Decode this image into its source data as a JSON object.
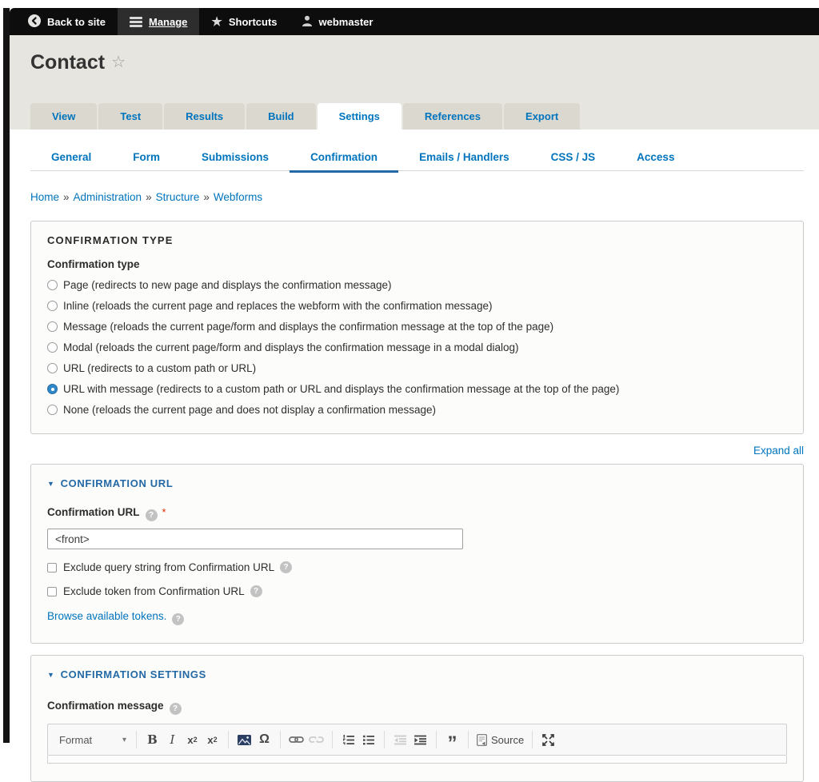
{
  "admin_toolbar": {
    "back_to_site": "Back to site",
    "manage": "Manage",
    "shortcuts": "Shortcuts",
    "user": "webmaster"
  },
  "header": {
    "title": "Contact"
  },
  "primary_tabs": {
    "items": [
      "View",
      "Test",
      "Results",
      "Build",
      "Settings",
      "References",
      "Export"
    ],
    "active_index": 4
  },
  "secondary_tabs": {
    "items": [
      "General",
      "Form",
      "Submissions",
      "Confirmation",
      "Emails / Handlers",
      "CSS / JS",
      "Access"
    ],
    "active_index": 3
  },
  "breadcrumb": {
    "items": [
      "Home",
      "Administration",
      "Structure",
      "Webforms"
    ],
    "separator": "»"
  },
  "confirmation_type": {
    "legend": "CONFIRMATION TYPE",
    "label": "Confirmation type",
    "options": [
      "Page (redirects to new page and displays the confirmation message)",
      "Inline (reloads the current page and replaces the webform with the confirmation message)",
      "Message (reloads the current page/form and displays the confirmation message at the top of the page)",
      "Modal (reloads the current page/form and displays the confirmation message in a modal dialog)",
      "URL (redirects to a custom path or URL)",
      "URL with message (redirects to a custom path or URL and displays the confirmation message at the top of the page)",
      "None (reloads the current page and does not display a confirmation message)"
    ],
    "selected_index": 5
  },
  "expand_all_label": "Expand all",
  "confirmation_url": {
    "summary": "CONFIRMATION URL",
    "label": "Confirmation URL",
    "value": "<front>",
    "exclude_query": "Exclude query string from Confirmation URL",
    "exclude_token": "Exclude token from Confirmation URL",
    "tokens_link": "Browse available tokens."
  },
  "confirmation_settings": {
    "summary": "CONFIRMATION SETTINGS",
    "message_label": "Confirmation message"
  },
  "editor": {
    "format_label": "Format",
    "bold": "B",
    "italic": "I",
    "subscript_base": "x",
    "subscript_mark": "2",
    "superscript_base": "x",
    "superscript_mark": "2",
    "special_char": "Ω",
    "blockquote": "”",
    "source_label": "Source"
  },
  "colors": {
    "link_blue": "#0074bd",
    "tab_underline": "#2369a6",
    "selected_radio": "#2e87c8",
    "required_red": "#e32700",
    "admin_bar": "#0d0d0d",
    "header_gray": "#e7e5df"
  }
}
